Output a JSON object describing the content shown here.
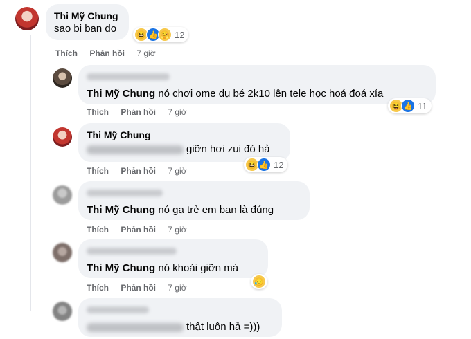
{
  "comments": [
    {
      "author": "Thi Mỹ Chung",
      "text": "sao bi ban do",
      "reaction_count": "12",
      "reactions": [
        "haha-icon",
        "like-icon",
        "care-icon"
      ],
      "actions": {
        "like": "Thích",
        "reply": "Phản hồi",
        "time": "7 giờ"
      }
    },
    {
      "tag": "Thi Mỹ Chung",
      "text": " nó chơi ome dụ bé 2k10 lên tele học hoá đoá xía",
      "reaction_count": "11",
      "reactions": [
        "haha-icon",
        "like-icon"
      ],
      "actions": {
        "like": "Thích",
        "reply": "Phản hồi",
        "time": "7 giờ"
      }
    },
    {
      "author": "Thi Mỹ Chung",
      "text": "giỡn hơi zui đó hả",
      "reaction_count": "12",
      "reactions": [
        "haha-icon",
        "like-icon"
      ],
      "actions": {
        "like": "Thích",
        "reply": "Phản hồi",
        "time": "7 giờ"
      }
    },
    {
      "tag": "Thi Mỹ Chung",
      "text": " nó gạ trẻ em ban là đúng",
      "actions": {
        "like": "Thích",
        "reply": "Phản hồi",
        "time": "7 giờ"
      }
    },
    {
      "tag": "Thi Mỹ Chung",
      "text": " nó khoái giỡn mà",
      "reactions": [
        "sad-icon"
      ],
      "actions": {
        "like": "Thích",
        "reply": "Phản hồi",
        "time": "7 giờ"
      }
    },
    {
      "text": "thật luôn hả =)))"
    }
  ],
  "colors": {
    "bubble": "#f0f2f5",
    "meta": "#65676b",
    "like_blue": "#1b74e4"
  }
}
